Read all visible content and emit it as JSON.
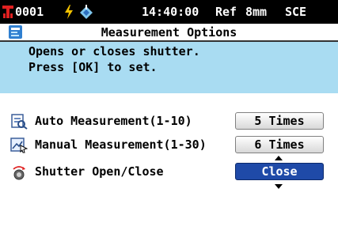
{
  "status_bar": {
    "sample_number": "0001",
    "time": "14:40:00",
    "mode_reference": "Ref",
    "aperture": "8mm",
    "specular": "SCE",
    "icons": [
      "device-icon",
      "power-icon",
      "calibration-icon"
    ]
  },
  "header": {
    "title": "Measurement Options",
    "icon": "settings-icon"
  },
  "help": {
    "line1": "Opens or closes shutter.",
    "line2": "Press [OK] to set."
  },
  "options": [
    {
      "label": "Auto Measurement(1-10)",
      "value": "5 Times",
      "icon": "auto-measurement-icon",
      "selected": false
    },
    {
      "label": "Manual Measurement(1-30)",
      "value": "6 Times",
      "icon": "manual-measurement-icon",
      "selected": false
    },
    {
      "label": "Shutter Open/Close",
      "value": "Close",
      "icon": "shutter-icon",
      "selected": true
    }
  ],
  "colors": {
    "help_background": "#a9dcf2",
    "selected_value": "#1f4aa8",
    "device_icon": "#e02020",
    "power_icon": "#f2c200"
  }
}
